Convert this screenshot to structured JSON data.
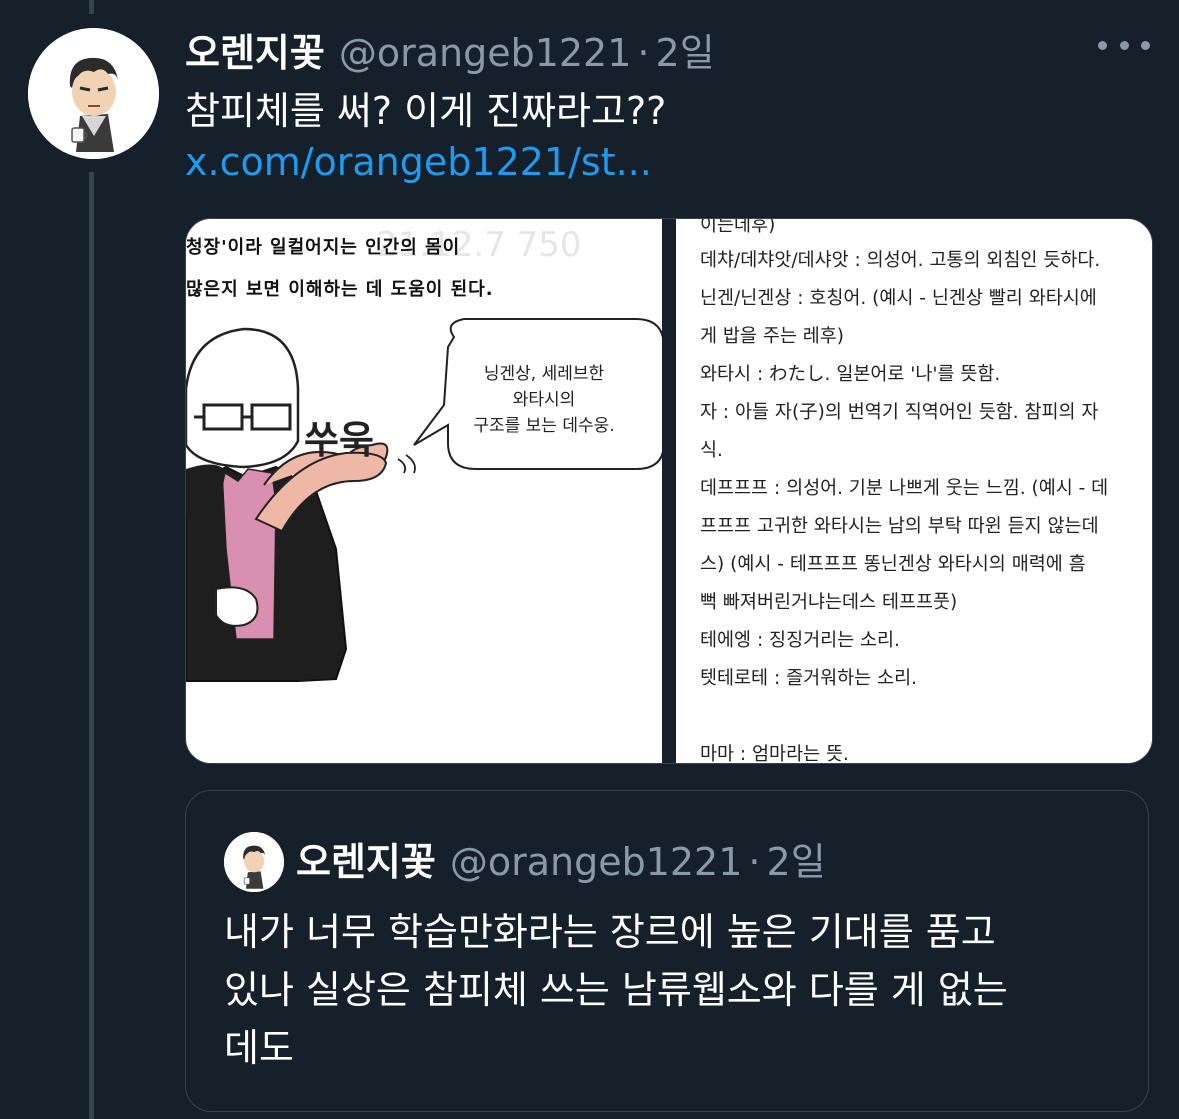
{
  "tweet": {
    "display_name": "오렌지꽃",
    "handle": "@orangeb1221",
    "separator": "·",
    "time": "2일",
    "text": "참피체를 써? 이게 진짜라고??",
    "link": "x.com/orangeb1221/st...",
    "more_icon": "more-horizontal-icon"
  },
  "media": {
    "left_panel": {
      "lines": [
        "청장'이라 일컬어지는 인간의 몸이",
        "많은지 보면 이해하는 데 도움이 된다."
      ],
      "watermark": "21.12.7 750",
      "speech_bubble": [
        "닝겐상, 세레브한",
        "와타시의",
        "구조를 보는 데수웅."
      ],
      "sfx": "쑤욱"
    },
    "right_panel": {
      "lines": [
        "이는데후)",
        "데챠/데챠앗/데샤앗 : 의성어. 고통의 외침인 듯하다.",
        "닌겐/닌겐상 : 호칭어. (예시 - 닌겐상 빨리 와타시에",
        "게 밥을 주는 레후)",
        "와타시 : わたし. 일본어로 '나'를 뜻함.",
        "자 : 아들 자(子)의 번역기 직역어인 듯함. 참피의 자",
        "식.",
        "데프프프 : 의성어. 기분 나쁘게 웃는 느낌. (예시 - 데",
        "프프프 고귀한 와타시는 남의 부탁 따윈 듣지 않는데",
        "스) (예시 - 테프프프 똥닌겐상 와타시의 매력에 흠",
        "뻑 빠져버린거냐는데스 테프프풋)",
        "테에엥 : 징징거리는 소리.",
        "텟테로테 : 즐거워하는 소리.",
        "",
        "마마 : 엄마라는 뜻."
      ]
    }
  },
  "quoted": {
    "display_name": "오렌지꽃",
    "handle": "@orangeb1221",
    "separator": "·",
    "time": "2일",
    "text_lines": [
      "내가 너무 학습만화라는 장르에 높은 기대를 품고",
      "있나 실상은 참피체 쓰는 남류웹소와 다를 게 없는",
      "데도"
    ]
  }
}
